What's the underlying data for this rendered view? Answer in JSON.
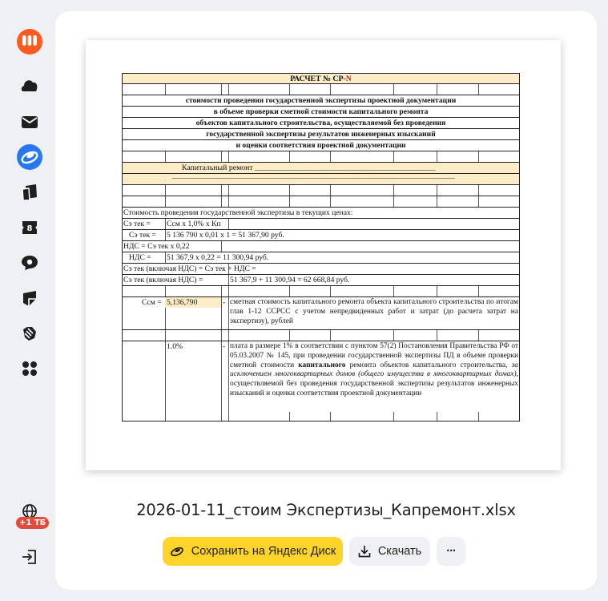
{
  "sidebar": {
    "items": [
      {
        "icon": "yandex-360-logo-icon"
      },
      {
        "icon": "cloud-icon"
      },
      {
        "icon": "mail-icon"
      },
      {
        "icon": "disk-icon",
        "active": true
      },
      {
        "icon": "documents-icon"
      },
      {
        "icon": "calendar-icon",
        "label": "8"
      },
      {
        "icon": "messenger-icon"
      },
      {
        "icon": "notes-icon"
      },
      {
        "icon": "telemost-icon"
      },
      {
        "icon": "apps-grid-icon"
      }
    ],
    "storage_badge": "+1 ТБ",
    "logout_icon": "logout-icon"
  },
  "document": {
    "title_prefix": "РАСЧЕТ № СР-",
    "title_suffix": "N",
    "subtitle_lines": [
      "стоимости проведения государственной экспертизы проектной документации",
      "в объеме проверки сметной стоимости капитального ремонта",
      "объектов капитального строительства, осуществляемой без проведения",
      "государственной экспертизы результатов инженерных изысканий",
      "и оценки соответствия проектной документации"
    ],
    "repair_label": "Капитальный ремонт ______________________________________________",
    "repair_underline": "________________________________________________________________________",
    "current_price_label": "Стоимость проведения государственной экспертизы в текущих ценах:",
    "f1_left": "Сэ тек =",
    "f1_right": "Ссм х 1,0% х Кп",
    "f2_left": "Сэ тек =",
    "f2_right": "5 136 790 х 0,01 х 1 = 51 367,90 руб.",
    "f3": "НДС = Сэ тек х 0,22",
    "f4_left": "НДС =",
    "f4_right": "51 367,9 х 0,22 = 11 300,94 руб.",
    "f5": "Сэ тек (включая НДС) = Сэ тек + НДС =",
    "f6_left": "Сэ тек (включая НДС) =",
    "f6_right": "51 367,9 + 11 300,94 = 62 668,84 руб.",
    "ssm_label": "Ссм =",
    "ssm_value": "5,136,790",
    "dash": "-",
    "ssm_desc": "сметная стоимость капитального ремонта объекта капитального строительства по итогам глав 1-12 ССРСС с учетом непредвиденных работ и затрат (до расчета затрат на экспертизу), рублей",
    "pct_value": "1.0%",
    "pct_desc_1": "плата в размере 1% в соответствии с пунктом 57(2) Постановления Правительства РФ от 05.03.2007 № 145, при проведении государственной экспертизы ПД в объеме проверки сметной стоимости ",
    "pct_desc_bold": "капитального",
    "pct_desc_2": " ремонта объектов капитального строительства, ",
    "pct_desc_italic": "за исключением многоквартирных домов (общего имущества в многоквартирных домах)",
    "pct_desc_3": ", осуществляемой без проведения государственной экспертизы результатов инженерных изысканий и оценки соответствия проектной документации"
  },
  "file": {
    "name": "2026-01-11_стоим Экспертизы_Капремонт.xlsx"
  },
  "actions": {
    "save_label": "Сохранить на Яндекс Диск",
    "download_label": "Скачать",
    "more_label": "···"
  },
  "colors": {
    "save_button": "#fed42b",
    "accent_blue": "#2877f2",
    "logo_orange": "#fc5a1f",
    "badge_red": "#e24a3b",
    "sheet_yellow": "#fdecc8"
  }
}
